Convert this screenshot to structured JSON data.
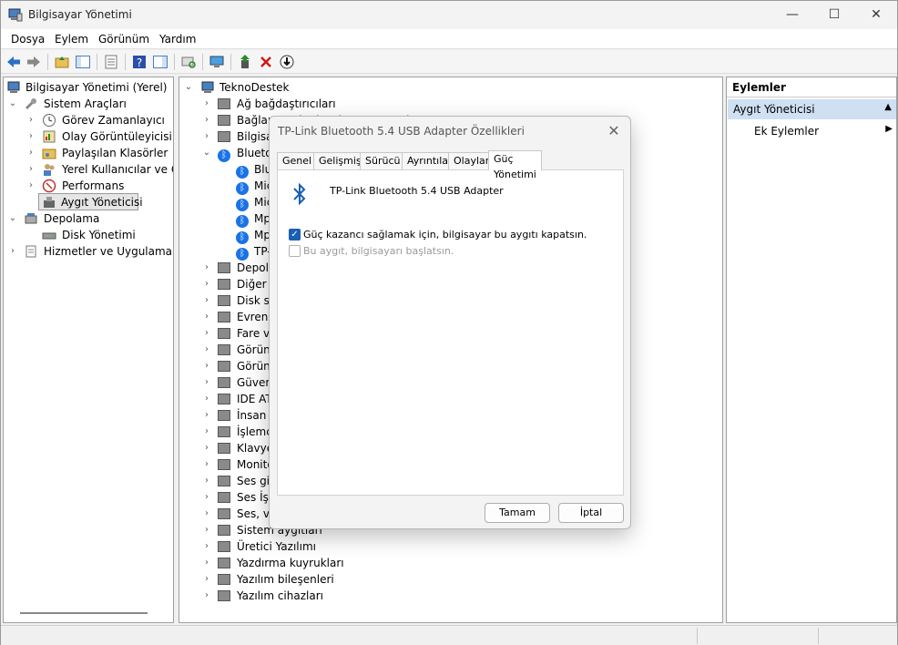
{
  "window": {
    "title": "Bilgisayar Yönetimi",
    "controls": [
      "—",
      "☐",
      "✕"
    ]
  },
  "menu": [
    "Dosya",
    "Eylem",
    "Görünüm",
    "Yardım"
  ],
  "left_tree": {
    "root": "Bilgisayar Yönetimi (Yerel)",
    "items": [
      {
        "label": "Sistem Araçları"
      },
      {
        "label": "Görev Zamanlayıcı"
      },
      {
        "label": "Olay Görüntüleyicisi"
      },
      {
        "label": "Paylaşılan Klasörler"
      },
      {
        "label": "Yerel Kullanıcılar ve Gru"
      },
      {
        "label": "Performans"
      },
      {
        "label": "Aygıt Yöneticisi"
      },
      {
        "label": "Depolama"
      },
      {
        "label": "Disk Yönetimi"
      },
      {
        "label": "Hizmetler ve Uygulamalar"
      }
    ]
  },
  "device_tree": {
    "root": "TeknoDestek",
    "items": [
      "Ağ bağdaştırıcıları",
      "Bağlantı noktaları (COM ve LPT)",
      "Bilgisa",
      "Blueto",
      "Blue",
      "Mic",
      "Mic",
      "Mp",
      "Mp",
      "TP-",
      "Depola",
      "Diğer a",
      "Disk sü",
      "Evrens",
      "Fare ve",
      "Görünt",
      "Görünt",
      "Güvenl",
      "IDE AT",
      "İnsan A",
      "İşlemci",
      "Klavyel",
      "Monitö",
      "Ses giri",
      "Ses İşle",
      "Ses, vid",
      "Sistem aygıtları",
      "Üretici Yazılımı",
      "Yazdırma kuyrukları",
      "Yazılım bileşenleri",
      "Yazılım cihazları"
    ]
  },
  "actions": {
    "header": "Eylemler",
    "section": "Aygıt Yöneticisi",
    "more": "Ek Eylemler"
  },
  "dialog": {
    "title": "TP-Link Bluetooth 5.4 USB Adapter Özellikleri",
    "close": "✕",
    "tabs": [
      "Genel",
      "Gelişmiş",
      "Sürücü",
      "Ayrıntılar",
      "Olaylar",
      "Güç Yönetimi"
    ],
    "device_name": "TP-Link Bluetooth 5.4 USB Adapter",
    "option1": "Güç kazancı sağlamak için, bilgisayar bu aygıtı kapatsın.",
    "option2": "Bu aygıt, bilgisayarı başlatsın.",
    "ok": "Tamam",
    "cancel": "İptal"
  },
  "colors": {
    "accent": "#1a5fb4",
    "selection": "#cfe0f3",
    "bluetooth": "#1a73e8"
  }
}
